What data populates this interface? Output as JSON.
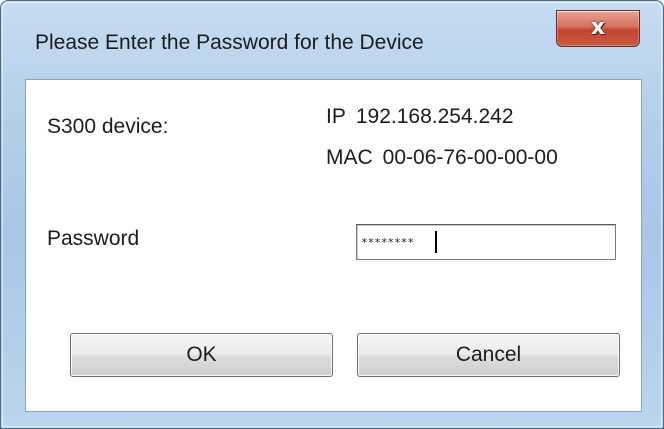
{
  "window": {
    "title": "Please Enter the Password for the Device",
    "close_glyph": "x"
  },
  "device": {
    "label": "S300 device:",
    "ip_prefix": "IP",
    "ip_value": "192.168.254.242",
    "mac_prefix": "MAC",
    "mac_value": "00-06-76-00-00-00"
  },
  "password": {
    "label": "Password",
    "value": "********"
  },
  "buttons": {
    "ok_label": "OK",
    "cancel_label": "Cancel"
  },
  "colors": {
    "frame": "#b3cde9",
    "close_button": "#c8503a",
    "client_background": "#ffffff"
  },
  "icons": {
    "close": "close-icon"
  }
}
